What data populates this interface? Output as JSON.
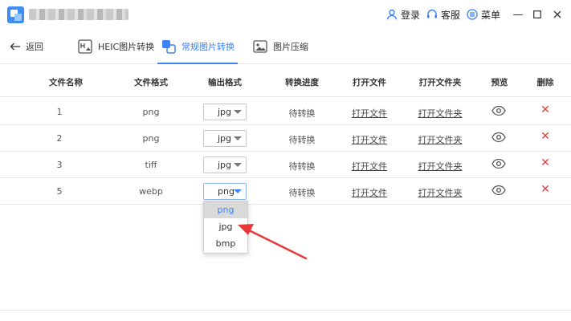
{
  "titlebar": {
    "login": "登录",
    "support": "客服",
    "menu": "菜单"
  },
  "nav": {
    "back": "返回",
    "tabs": [
      {
        "label": "HEIC图片转换",
        "icon": "heic-icon",
        "active": false
      },
      {
        "label": "常规图片转换",
        "icon": "convert-icon",
        "active": true
      },
      {
        "label": "图片压缩",
        "icon": "image-compress-icon",
        "active": false
      }
    ]
  },
  "table": {
    "headers": [
      "文件名称",
      "文件格式",
      "输出格式",
      "转换进度",
      "打开文件",
      "打开文件夹",
      "预览",
      "删除"
    ],
    "rows": [
      {
        "name": "1",
        "format": "png",
        "output": "jpg",
        "progress": "待转换",
        "open_file": "打开文件",
        "open_folder": "打开文件夹"
      },
      {
        "name": "2",
        "format": "png",
        "output": "jpg",
        "progress": "待转换",
        "open_file": "打开文件",
        "open_folder": "打开文件夹"
      },
      {
        "name": "3",
        "format": "tiff",
        "output": "jpg",
        "progress": "待转换",
        "open_file": "打开文件",
        "open_folder": "打开文件夹"
      },
      {
        "name": "5",
        "format": "webp",
        "output": "png",
        "progress": "待转换",
        "open_file": "打开文件",
        "open_folder": "打开文件夹"
      }
    ]
  },
  "dropdown": {
    "options": [
      "png",
      "jpg",
      "bmp"
    ],
    "selected": "png"
  },
  "colors": {
    "accent": "#3b82f6",
    "delete": "#e04040",
    "annotation_arrow": "#e8393a"
  }
}
